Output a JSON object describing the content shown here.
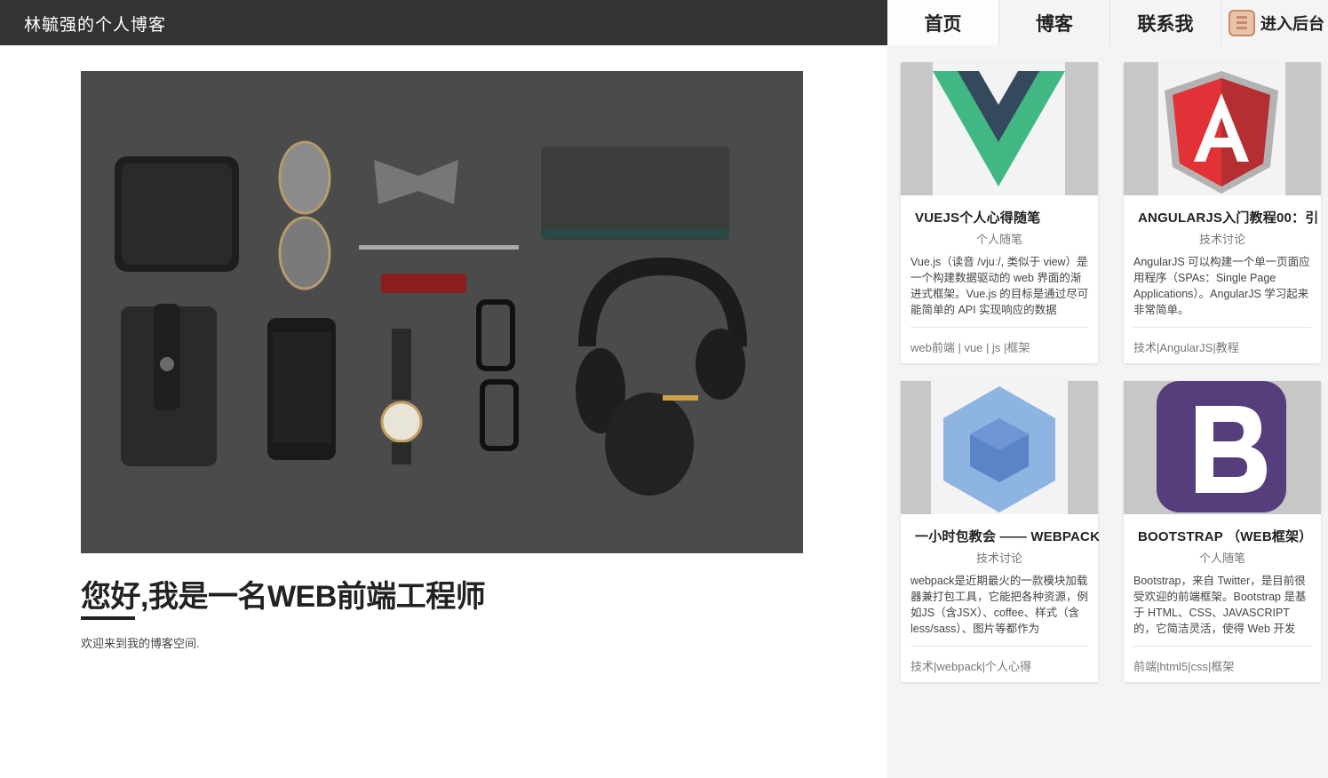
{
  "header": {
    "site_title": "林毓强的个人博客"
  },
  "nav": {
    "items": [
      {
        "label": "首页"
      },
      {
        "label": "博客"
      },
      {
        "label": "联系我"
      },
      {
        "label": "进入后台"
      }
    ]
  },
  "hero": {
    "title": "您好,我是一名WEB前端工程师",
    "subtitle": "欢迎来到我的博客空间."
  },
  "cards": [
    {
      "title": "VUEJS个人心得随笔",
      "category": "个人随笔",
      "desc": "Vue.js（读音 /vjuː/, 类似于 view）是一个构建数据驱动的 web 界面的渐进式框架。Vue.js 的目标是通过尽可能简单的 API 实现响应的数据",
      "tags": "web前端 | vue | js |框架",
      "icon": "vue-logo-icon"
    },
    {
      "title": "ANGULARJS入门教程00：引",
      "category": "技术讨论",
      "desc": "AngularJS 可以构建一个单一页面应用程序（SPAs：Single Page Applications）。AngularJS 学习起来非常简单。",
      "tags": "技术|AngularJS|教程",
      "icon": "angular-logo-icon"
    },
    {
      "title": "一小时包教会 —— WEBPACK",
      "category": "技术讨论",
      "desc": "webpack是近期最火的一款模块加载器兼打包工具，它能把各种资源，例如JS（含JSX）、coffee、样式（含less/sass）、图片等都作为",
      "tags": "技术|webpack|个人心得",
      "icon": "webpack-logo-icon"
    },
    {
      "title": "BOOTSTRAP （WEB框架）",
      "category": "个人随笔",
      "desc": "Bootstrap，来自 Twitter，是目前很受欢迎的前端框架。Bootstrap 是基于 HTML、CSS、JAVASCRIPT 的，它简洁灵活，使得 Web 开发",
      "tags": "前端|html5|css|框架",
      "icon": "bootstrap-logo-icon"
    }
  ]
}
